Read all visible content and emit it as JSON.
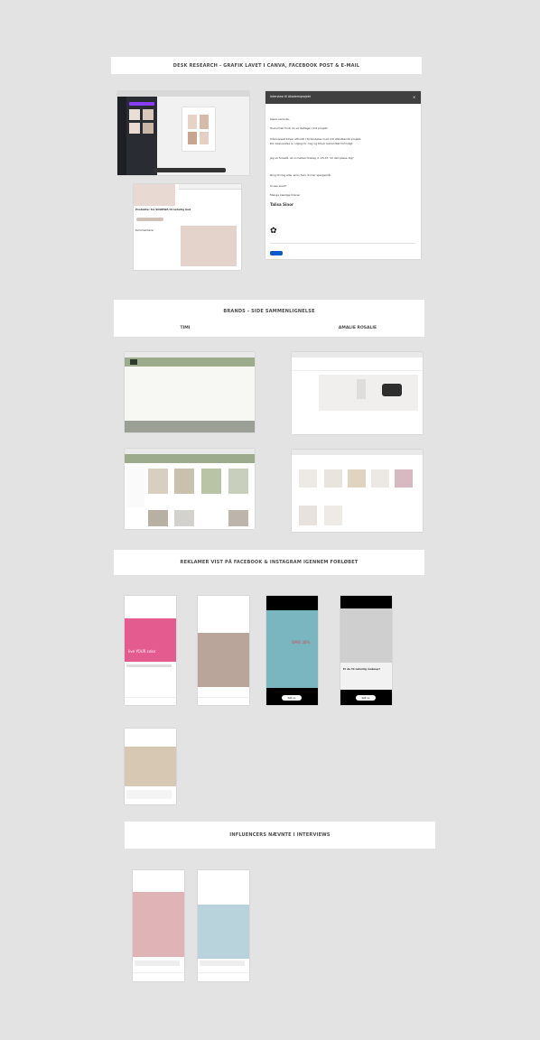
{
  "sections": {
    "desk_research": "DESK RESEARCH - GRAFIK LAVET I CANVA, FACEBOOK POST & E-MAIL",
    "brands": "BRANDS - SIDE SAMMENLIGNELSE",
    "brand_left": "TIMI",
    "brand_right": "AMALIE ROSALIE",
    "ads": "REKLAMER VIST PÅ FACEBOOK & INSTAGRAM IGENNEM  FORLØBET",
    "influencers": "INFLUENCERS NÆVNTE I INTERVIEWS"
  },
  "email": {
    "subject": "Interview til Akademiprojekt",
    "greeting": "Kære veninde,",
    "lines": [
      "Tusind tak fordi du vil deltage i mit projekt.",
      "Interviewet bliver afholdt i forbindelse med mit afsluttende projekt.",
      "Din besvarelse er vigtig for mig og bliver behandlet fortroligt.",
      "Jeg vil foreslå, at vi mødes tirsdag d. 25.07. Vil det passe dig?",
      "Ring til mig eller skriv hvis du har spørgsmål.",
      "Vi ses snart!",
      "Mange kærlige hilsner"
    ],
    "signature": "Talisa Sinor"
  },
  "facebook_post": {
    "title": "Produkter fra SOOHWA til naturlig hud",
    "comments_label": "Kommentarer"
  },
  "ads": {
    "ad1_text": "live YOUR color",
    "ad3_text": "SPAR 38%",
    "ad4_text": "Er du til naturlig makeup?",
    "cta": "Køb nu"
  },
  "colors": {
    "bg": "#e3e3e3",
    "band": "#ffffff",
    "sage": "#8fa07f",
    "pink": "#e35b8f",
    "teal": "#7ab6c0"
  }
}
